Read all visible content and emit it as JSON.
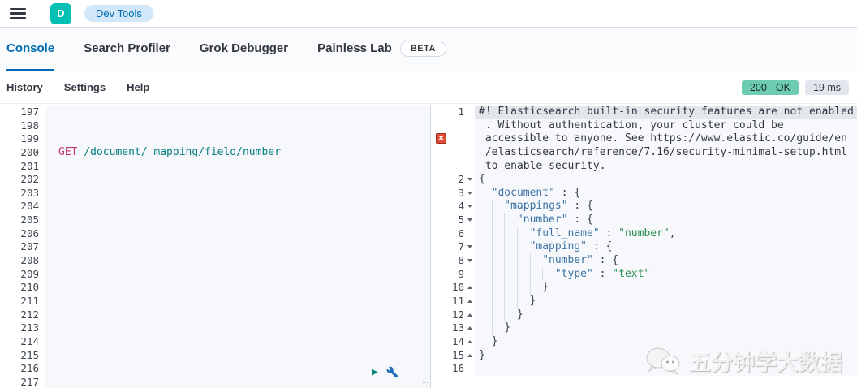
{
  "topbar": {
    "logo_letter": "D",
    "breadcrumb": "Dev Tools"
  },
  "tabs": [
    {
      "label": "Console",
      "active": true
    },
    {
      "label": "Search Profiler",
      "active": false
    },
    {
      "label": "Grok Debugger",
      "active": false
    },
    {
      "label": "Painless Lab",
      "active": false,
      "beta": "BETA"
    }
  ],
  "toolbar": {
    "items": [
      "History",
      "Settings",
      "Help"
    ],
    "status": {
      "code": "200 - OK",
      "time": "19 ms"
    }
  },
  "icons": {
    "play_icon": "▶",
    "error_icon": "✕"
  },
  "colors": {
    "accent_teal": "#00BFB3",
    "link_blue": "#006BB4",
    "status_ok_green": "#6DCCB1",
    "badge_gray": "#E2E7EE",
    "method_pink": "#C4306E",
    "url_teal": "#067E82",
    "json_key_blue": "#3D73A6",
    "json_string_green": "#278C4C",
    "error_red": "#DE4B32"
  },
  "request_editor": {
    "first_line": 197,
    "last_line": 217,
    "request": {
      "line": 200,
      "method": "GET",
      "url": " /document/_mapping/field/number"
    }
  },
  "response_editor": {
    "rows": [
      {
        "num": "1",
        "hl": true,
        "segs": [
          {
            "c": "sw",
            "s": "#! Elasticsearch built-in security features are not enabled"
          }
        ]
      },
      {
        "cont": true,
        "segs": [
          {
            "c": "sw",
            "s": ". Without authentication, your cluster could be"
          }
        ]
      },
      {
        "cont": true,
        "icon": "error",
        "segs": [
          {
            "c": "sw",
            "s": "accessible to anyone. See https://www.elastic.co/guide/en"
          }
        ]
      },
      {
        "cont": true,
        "segs": [
          {
            "c": "sw",
            "s": "/elasticsearch/reference/7.16/security-minimal-setup.html"
          }
        ]
      },
      {
        "cont": true,
        "segs": [
          {
            "c": "sw",
            "s": "to enable security."
          }
        ]
      },
      {
        "num": "2",
        "fold": "open",
        "indent": 0,
        "segs": [
          {
            "c": "sp",
            "s": "{"
          }
        ]
      },
      {
        "num": "3",
        "fold": "open",
        "indent": 1,
        "segs": [
          {
            "c": "sk",
            "s": "\"document\""
          },
          {
            "c": "sp",
            "s": " : {"
          }
        ]
      },
      {
        "num": "4",
        "fold": "open",
        "indent": 2,
        "segs": [
          {
            "c": "sk",
            "s": "\"mappings\""
          },
          {
            "c": "sp",
            "s": " : {"
          }
        ]
      },
      {
        "num": "5",
        "fold": "open",
        "indent": 3,
        "segs": [
          {
            "c": "sk",
            "s": "\"number\""
          },
          {
            "c": "sp",
            "s": " : {"
          }
        ]
      },
      {
        "num": "6",
        "indent": 4,
        "segs": [
          {
            "c": "sk",
            "s": "\"full_name\""
          },
          {
            "c": "sp",
            "s": " : "
          },
          {
            "c": "ss",
            "s": "\"number\""
          },
          {
            "c": "sp",
            "s": ","
          }
        ]
      },
      {
        "num": "7",
        "fold": "open",
        "indent": 4,
        "segs": [
          {
            "c": "sk",
            "s": "\"mapping\""
          },
          {
            "c": "sp",
            "s": " : {"
          }
        ]
      },
      {
        "num": "8",
        "fold": "open",
        "indent": 5,
        "segs": [
          {
            "c": "sk",
            "s": "\"number\""
          },
          {
            "c": "sp",
            "s": " : {"
          }
        ]
      },
      {
        "num": "9",
        "indent": 6,
        "segs": [
          {
            "c": "sk",
            "s": "\"type\""
          },
          {
            "c": "sp",
            "s": " : "
          },
          {
            "c": "ss",
            "s": "\"text\""
          }
        ]
      },
      {
        "num": "10",
        "fold": "close",
        "indent": 5,
        "segs": [
          {
            "c": "sp",
            "s": "}"
          }
        ]
      },
      {
        "num": "11",
        "fold": "close",
        "indent": 4,
        "segs": [
          {
            "c": "sp",
            "s": "}"
          }
        ]
      },
      {
        "num": "12",
        "fold": "close",
        "indent": 3,
        "segs": [
          {
            "c": "sp",
            "s": "}"
          }
        ]
      },
      {
        "num": "13",
        "fold": "close",
        "indent": 2,
        "segs": [
          {
            "c": "sp",
            "s": "}"
          }
        ]
      },
      {
        "num": "14",
        "fold": "close",
        "indent": 1,
        "segs": [
          {
            "c": "sp",
            "s": "}"
          }
        ]
      },
      {
        "num": "15",
        "fold": "close",
        "indent": 0,
        "segs": [
          {
            "c": "sp",
            "s": "}"
          }
        ]
      },
      {
        "num": "16",
        "indent": 0,
        "segs": []
      }
    ]
  },
  "watermark": {
    "text": "五分钟学大数据"
  }
}
